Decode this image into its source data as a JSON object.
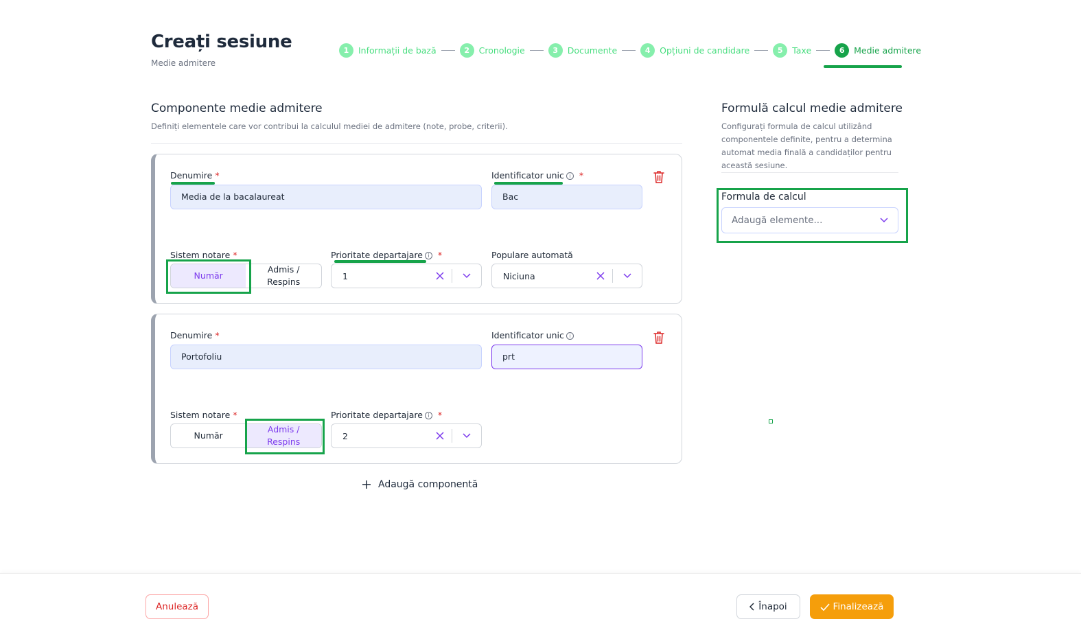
{
  "header": {
    "title": "Creați sesiune",
    "subtitle": "Medie admitere"
  },
  "stepper": [
    {
      "num": "1",
      "label": "Informații de bază"
    },
    {
      "num": "2",
      "label": "Cronologie"
    },
    {
      "num": "3",
      "label": "Documente"
    },
    {
      "num": "4",
      "label": "Opțiuni de candidare"
    },
    {
      "num": "5",
      "label": "Taxe"
    },
    {
      "num": "6",
      "label": "Medie admitere",
      "active": true
    }
  ],
  "components": {
    "title": "Componente medie admitere",
    "description": "Definiți elementele care vor contribui la calculul mediei de admitere (note, probe, criterii).",
    "labels": {
      "name": "Denumire",
      "identifier": "Identificator unic",
      "grading": "Sistem notare",
      "priority": "Prioritate departajare",
      "auto_fill": "Populare automată",
      "required_mark": "*",
      "info_glyph": "i"
    },
    "grading_options": [
      "Număr",
      "Admis / Respins"
    ],
    "items": [
      {
        "name": "Media de la bacalaureat",
        "identifier": "Bac",
        "grading_selected": "Număr",
        "priority": "1",
        "auto_fill": "Niciuna"
      },
      {
        "name": "Portofoliu",
        "identifier": "prt",
        "grading_selected": "Admis / Respins",
        "priority": "2"
      }
    ],
    "add_label": "Adaugă componentă"
  },
  "formula": {
    "title": "Formulă calcul medie admitere",
    "description": "Configurați formula de calcul utilizând componentele definite, pentru a determina automat media finală a candidaților pentru această sesiune.",
    "field_label": "Formula de calcul",
    "placeholder": "Adaugă elemente..."
  },
  "footer": {
    "cancel": "Anulează",
    "back": "Înapoi",
    "finish": "Finalizează"
  },
  "colors": {
    "accent_green": "#16a34a",
    "accent_purple": "#7c3aed",
    "finish_orange": "#f59e0b",
    "danger_red": "#dc2626"
  }
}
